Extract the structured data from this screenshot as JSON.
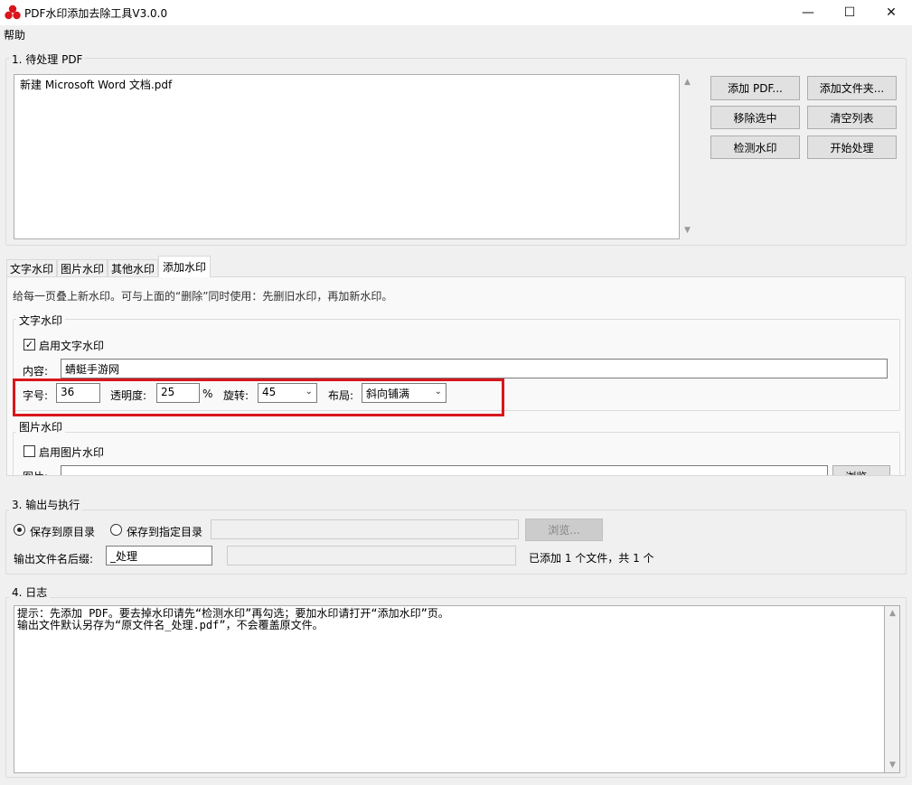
{
  "window": {
    "title": "PDF水印添加去除工具V3.0.0",
    "minimize_glyph": "—",
    "maximize_glyph": "☐",
    "close_glyph": "✕",
    "icon": "app-logo-icon",
    "icon_color": "#d9161c"
  },
  "menu": {
    "help": "帮助"
  },
  "section1": {
    "title": "1. 待处理 PDF",
    "files": [
      "新建 Microsoft Word 文档.pdf"
    ],
    "buttons": {
      "add_pdf": "添加 PDF...",
      "add_folder": "添加文件夹...",
      "remove_selected": "移除选中",
      "clear_list": "清空列表",
      "detect_watermark": "检测水印",
      "start_process": "开始处理"
    }
  },
  "tabs": [
    {
      "label": "文字水印"
    },
    {
      "label": "图片水印"
    },
    {
      "label": "其他水印"
    },
    {
      "label": "添加水印",
      "active": true
    }
  ],
  "add_watermark": {
    "hint": "给每一页叠上新水印。可与上面的“删除”同时使用：先删旧水印，再加新水印。",
    "text_group": {
      "title": "文字水印",
      "enable_label": "启用文字水印",
      "enabled": true,
      "content_label": "内容:",
      "content_value": "蜻蜓手游网",
      "font_size_label": "字号:",
      "font_size_value": "36",
      "opacity_label": "透明度:",
      "opacity_value": "25",
      "opacity_unit": "%",
      "rotation_label": "旋转:",
      "rotation_value": "45",
      "layout_label": "布局:",
      "layout_value": "斜向铺满"
    },
    "image_group": {
      "title": "图片水印",
      "enable_label": "启用图片水印",
      "enabled": false,
      "image_label": "图片:",
      "browse_label": "浏览..."
    }
  },
  "section3": {
    "title": "3. 输出与执行",
    "save_original": "保存到原目录",
    "save_custom": "保存到指定目录",
    "browse": "浏览...",
    "suffix_label": "输出文件名后缀:",
    "suffix_value": "_处理",
    "status": "已添加 1 个文件，共 1 个"
  },
  "section4": {
    "title": "4. 日志",
    "lines": [
      "提示：先添加 PDF。要去掉水印请先“检测水印”再勾选；要加水印请打开“添加水印”页。",
      "输出文件默认另存为“原文件名_处理.pdf”，不会覆盖原文件。"
    ]
  },
  "colors": {
    "highlight": "#d9161c",
    "window_bg": "#f0f0f0"
  }
}
